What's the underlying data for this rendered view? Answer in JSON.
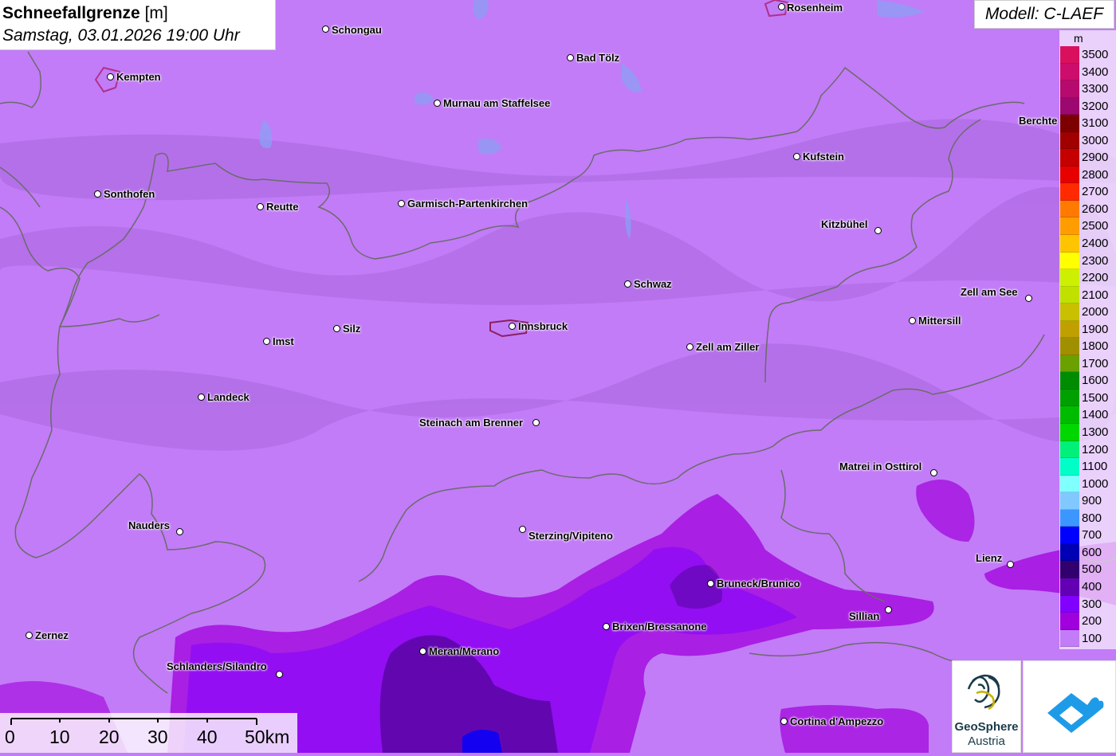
{
  "title": {
    "main": "Schneefallgrenze",
    "unit": "[m]",
    "datetime": "Samstag, 03.01.2026 19:00 Uhr"
  },
  "model": "Modell: C-LAEF",
  "legend": {
    "unit": "m",
    "levels": [
      {
        "label": "3500",
        "color": "#d9105e"
      },
      {
        "label": "3400",
        "color": "#cc0d6c"
      },
      {
        "label": "3300",
        "color": "#b60a6e"
      },
      {
        "label": "3200",
        "color": "#9c0870"
      },
      {
        "label": "3100",
        "color": "#7d0000"
      },
      {
        "label": "3000",
        "color": "#a00000"
      },
      {
        "label": "2900",
        "color": "#c40000"
      },
      {
        "label": "2800",
        "color": "#e60000"
      },
      {
        "label": "2700",
        "color": "#ff2a00"
      },
      {
        "label": "2600",
        "color": "#ff7a00"
      },
      {
        "label": "2500",
        "color": "#ff9d00"
      },
      {
        "label": "2400",
        "color": "#ffc400"
      },
      {
        "label": "2300",
        "color": "#ffff00"
      },
      {
        "label": "2200",
        "color": "#ccf000"
      },
      {
        "label": "2100",
        "color": "#c0e000"
      },
      {
        "label": "2000",
        "color": "#c8c000"
      },
      {
        "label": "1900",
        "color": "#c0a000"
      },
      {
        "label": "1800",
        "color": "#a09000"
      },
      {
        "label": "1700",
        "color": "#6aa000"
      },
      {
        "label": "1600",
        "color": "#008c00"
      },
      {
        "label": "1500",
        "color": "#00a000"
      },
      {
        "label": "1400",
        "color": "#00bc00"
      },
      {
        "label": "1300",
        "color": "#00d700"
      },
      {
        "label": "1200",
        "color": "#00f07a"
      },
      {
        "label": "1100",
        "color": "#00ffc8"
      },
      {
        "label": "1000",
        "color": "#80ffff"
      },
      {
        "label": "900",
        "color": "#80c8ff"
      },
      {
        "label": "800",
        "color": "#3c96ff"
      },
      {
        "label": "700",
        "color": "#0000ff"
      },
      {
        "label": "600",
        "color": "#0000b4"
      },
      {
        "label": "500",
        "color": "#32006e"
      },
      {
        "label": "400",
        "color": "#6400b4"
      },
      {
        "label": "300",
        "color": "#8200ff"
      },
      {
        "label": "200",
        "color": "#a000dc"
      },
      {
        "label": "100",
        "color": "#c27cf7"
      }
    ]
  },
  "cities": [
    {
      "name": "Rosenheim"
    },
    {
      "name": "Schongau"
    },
    {
      "name": "Kempten"
    },
    {
      "name": "Bad Tölz"
    },
    {
      "name": "Murnau am Staffelsee"
    },
    {
      "name": "Berchte"
    },
    {
      "name": "Kufstein"
    },
    {
      "name": "Sonthofen"
    },
    {
      "name": "Reutte"
    },
    {
      "name": "Garmisch-Partenkirchen"
    },
    {
      "name": "Kitzbühel"
    },
    {
      "name": "Schwaz"
    },
    {
      "name": "Zell am See"
    },
    {
      "name": "Mittersill"
    },
    {
      "name": "Silz"
    },
    {
      "name": "Innsbruck"
    },
    {
      "name": "Imst"
    },
    {
      "name": "Zell am Ziller"
    },
    {
      "name": "Landeck"
    },
    {
      "name": "Steinach am Brenner"
    },
    {
      "name": "Matrei in Osttirol"
    },
    {
      "name": "Nauders"
    },
    {
      "name": "Sterzing/Vipiteno"
    },
    {
      "name": "Lienz"
    },
    {
      "name": "Bruneck/Brunico"
    },
    {
      "name": "Sillian"
    },
    {
      "name": "Brixen/Bressanone"
    },
    {
      "name": "Zernez"
    },
    {
      "name": "Meran/Merano"
    },
    {
      "name": "Schlanders/Silandro"
    },
    {
      "name": "Cortina d'Ampezzo"
    }
  ],
  "scale": {
    "labels": [
      "0",
      "10",
      "20",
      "30",
      "40",
      "50km"
    ]
  },
  "logo": {
    "line1": "GeoSphere",
    "line2": "Austria"
  }
}
